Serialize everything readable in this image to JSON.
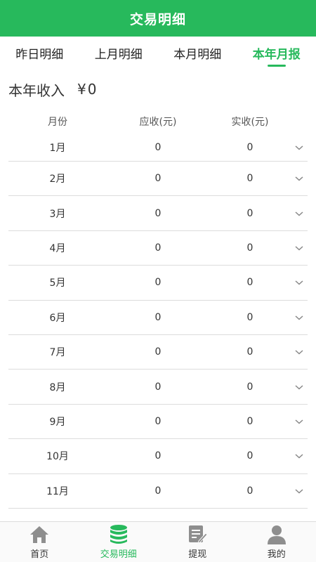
{
  "header": {
    "title": "交易明细"
  },
  "tabs": [
    {
      "label": "昨日明细",
      "active": false
    },
    {
      "label": "上月明细",
      "active": false
    },
    {
      "label": "本月明细",
      "active": false
    },
    {
      "label": "本年月报",
      "active": true
    }
  ],
  "income": {
    "label": "本年收入",
    "currency": "¥",
    "amount": "0"
  },
  "table": {
    "headers": {
      "month": "月份",
      "due": "应收(元)",
      "paid": "实收(元)"
    },
    "rows": [
      {
        "month": "1月",
        "due": "0",
        "paid": "0"
      },
      {
        "month": "2月",
        "due": "0",
        "paid": "0"
      },
      {
        "month": "3月",
        "due": "0",
        "paid": "0"
      },
      {
        "month": "4月",
        "due": "0",
        "paid": "0"
      },
      {
        "month": "5月",
        "due": "0",
        "paid": "0"
      },
      {
        "month": "6月",
        "due": "0",
        "paid": "0"
      },
      {
        "month": "7月",
        "due": "0",
        "paid": "0"
      },
      {
        "month": "8月",
        "due": "0",
        "paid": "0"
      },
      {
        "month": "9月",
        "due": "0",
        "paid": "0"
      },
      {
        "month": "10月",
        "due": "0",
        "paid": "0"
      },
      {
        "month": "11月",
        "due": "0",
        "paid": "0"
      }
    ]
  },
  "tabbar": [
    {
      "label": "首页",
      "icon": "home-icon",
      "active": false
    },
    {
      "label": "交易明细",
      "icon": "database-icon",
      "active": true
    },
    {
      "label": "提现",
      "icon": "edit-document-icon",
      "active": false
    },
    {
      "label": "我的",
      "icon": "user-icon",
      "active": false
    }
  ],
  "colors": {
    "accent": "#27b95c",
    "text": "#222222",
    "divider": "#dcdcdc",
    "icon_gray": "#8e8e8e"
  }
}
